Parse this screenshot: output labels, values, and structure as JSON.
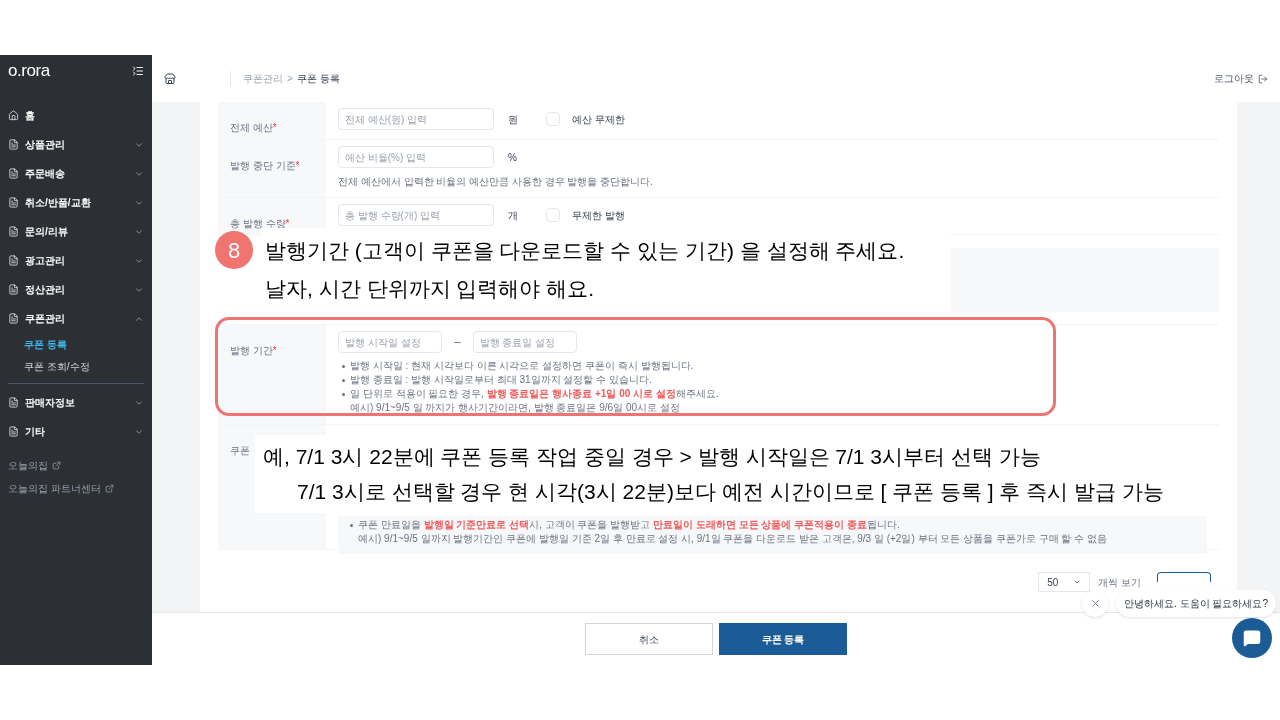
{
  "logo": "o.rora",
  "sidebar": {
    "items": [
      {
        "label": "홈",
        "kind": "home",
        "divider_before": false
      },
      {
        "label": "상품관리",
        "kind": "menu",
        "expanded": false,
        "divider_before": false
      },
      {
        "label": "주문배송",
        "kind": "menu",
        "expanded": false,
        "divider_before": false
      },
      {
        "label": "취소/반품/교환",
        "kind": "menu",
        "expanded": false,
        "divider_before": false
      },
      {
        "label": "문의/리뷰",
        "kind": "menu",
        "expanded": false,
        "divider_before": false
      },
      {
        "label": "광고관리",
        "kind": "menu",
        "expanded": false,
        "divider_before": false
      },
      {
        "label": "정산관리",
        "kind": "menu",
        "expanded": false,
        "divider_before": false
      },
      {
        "label": "쿠폰관리",
        "kind": "menu",
        "expanded": true,
        "divider_before": false,
        "children": [
          {
            "label": "쿠폰 등록",
            "selected": true
          },
          {
            "label": "쿠폰 조회/수정",
            "selected": false
          }
        ]
      },
      {
        "label": "판매자정보",
        "kind": "menu",
        "expanded": false,
        "divider_before": true
      },
      {
        "label": "기타",
        "kind": "menu",
        "expanded": false,
        "divider_before": false
      }
    ],
    "links": [
      "오늘의집",
      "오늘의집 파트너센터"
    ]
  },
  "header": {
    "breadcrumb": [
      "쿠폰관리",
      "쿠폰 등록"
    ],
    "separator": ">",
    "logout": "로그아웃"
  },
  "form": {
    "required_mark": "*",
    "rows": [
      {
        "label": "전체 예산",
        "required": true,
        "highlighted": false,
        "inputs": [
          {
            "placeholder": "전체 예산(원) 입력"
          }
        ],
        "unit": "원",
        "checkbox": {
          "label": "예산 무제한",
          "checked": false
        }
      },
      {
        "label": "발행 중단 기준",
        "required": true,
        "highlighted": false,
        "inputs": [
          {
            "placeholder": "예산 비율(%) 입력"
          }
        ],
        "unit": "%",
        "help": "전체 예산에서 입력한 비율의 예산만큼 사용한 경우 발행을 중단합니다."
      },
      {
        "label": "총 발행 수량",
        "required": true,
        "highlighted": false,
        "inputs": [
          {
            "placeholder": "총 발행 수량(개) 입력"
          }
        ],
        "unit": "개",
        "checkbox": {
          "label": "무제한 발행",
          "checked": false
        }
      },
      {
        "label": "발행 기간",
        "required": true,
        "highlighted": true,
        "inputs": [
          {
            "placeholder": "발행 시작일 설정"
          },
          {
            "placeholder": "발행 종료일 설정"
          }
        ],
        "separator": "–",
        "notes": [
          {
            "text": "발행 시작일 : 현재 시각보다 이른 시각으로 설정하면 쿠폰이 즉시 발행됩니다.",
            "bullet": true
          },
          {
            "text": "발행 종료일 : 발행 시작일로부터 최대 31일까지 설정할 수 있습니다.",
            "bullet": true
          },
          {
            "text": "일 단위로 적용이 필요한 경우, **발행 종료일은 행사종료 +1일 00 시로 설정**해주세요.",
            "bullet": true
          },
          {
            "text": "예시) 9/1~9/5 일 까지가 행사기간이라면, 발행 종료일은 9/6일 00시로 설정",
            "bullet": false
          }
        ]
      },
      {
        "label": "쿠폰",
        "required": false,
        "highlighted": false,
        "boxed_notes": [
          {
            "text": "쿠폰 만료일을 **발행일 기준만료로 선택**시, 고객이 쿠폰을 발행받고 **만료일이 도래하면 모든 상품에 쿠폰적용이 종료**됩니다.",
            "bullet": true
          },
          {
            "text": "예시) 9/1~9/5 일까지 발행기간인 쿠폰에 발행일 기준 2일 후 만료로 설정 시, 9/1일 쿠폰을 다운로드 받은 고객은, 9/3 일 (+2일) 부터 모든 상품을 쿠폰가로 구매 할 수 없음",
            "bullet": false
          }
        ]
      }
    ]
  },
  "pagination": {
    "page_size": "50",
    "label": "개씩 보기"
  },
  "footer": {
    "buttons": [
      {
        "label": "취소",
        "kind": "secondary"
      },
      {
        "label": "쿠폰 등록",
        "kind": "primary"
      }
    ]
  },
  "chat": {
    "greeting": "안녕하세요. 도움이 필요하세요?"
  },
  "annotations": {
    "step": "8",
    "lines": [
      "발행기간 (고객이 쿠폰을 다운로드할 수 있는 기간) 을 설정해 주세요.",
      "날자, 시간 단위까지 입력해야 해요."
    ],
    "example_lines": [
      "예, 7/1 3시 22분에 쿠폰 등록 작업 중일 경우 > 발행 시작일은 7/1 3시부터 선택 가능",
      "7/1 3시로 선택할 경우 현 시각(3시 22분)보다 예전 시간이므로 [ 쿠폰 등록 ] 후 즉시 발급 가능"
    ]
  }
}
